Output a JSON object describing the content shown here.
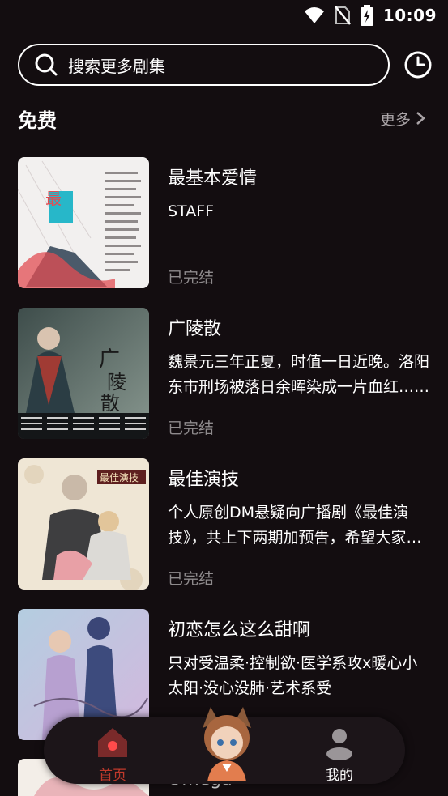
{
  "status_bar": {
    "time": "10:09",
    "icons": [
      "wifi-icon",
      "no-sim-icon",
      "battery-charging-icon"
    ]
  },
  "search": {
    "placeholder": "搜索更多剧集",
    "history_icon": "history-clock-icon"
  },
  "section": {
    "title": "免费",
    "more_label": "更多"
  },
  "items": [
    {
      "title": "最基本爱情",
      "desc": "STAFF",
      "status": "已完结",
      "cover_text": "最\n基\n本",
      "cover_colors": [
        "#f0f0f0",
        "#e24d53",
        "#27b7c9"
      ]
    },
    {
      "title": "广陵散",
      "desc": "魏景元三年正夏，时值一日近晚。洛阳东市刑场被落日余晖染成一片血红……",
      "status": "已完结",
      "cover_text": "广陵散",
      "cover_colors": [
        "#2d3a3a",
        "#596766",
        "#1b1f21"
      ]
    },
    {
      "title": "最佳演技",
      "desc": "个人原创DM悬疑向广播剧《最佳演技》，共上下两期加预告，希望大家喜欢",
      "status": "已完结",
      "cover_text": "最佳演技",
      "cover_colors": [
        "#efe6d5",
        "#4a4a4a",
        "#e8a0a6"
      ]
    },
    {
      "title": "初恋怎么这么甜啊",
      "desc": "只对受温柔·控制欲·医学系攻x暖心小太阳·没心没肺·艺术系受",
      "status": "",
      "cover_text": "",
      "cover_colors": [
        "#9db5cf",
        "#c8a6d6",
        "#4b5a88"
      ]
    }
  ],
  "partial_item": {
    "title_fragment": "Omega"
  },
  "nav": {
    "home_label": "首页",
    "me_label": "我的",
    "accent": "#c0392b"
  }
}
